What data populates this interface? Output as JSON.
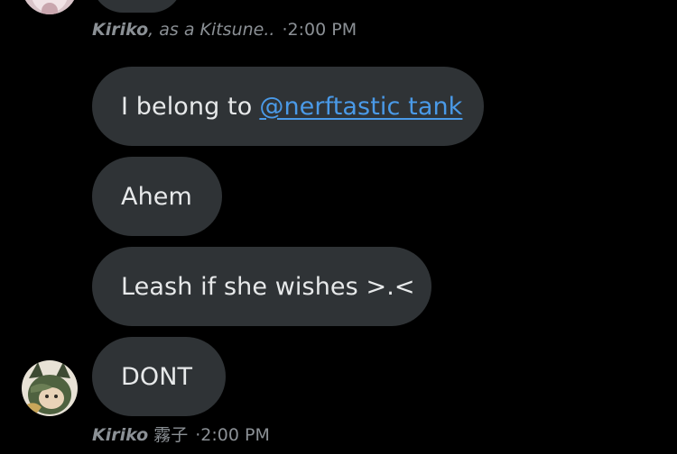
{
  "messages": [
    {
      "text": "I belong to",
      "mention": "@nerftastic tank"
    },
    {
      "text": "Ahem"
    },
    {
      "text": "Leash if she wishes >.<"
    },
    {
      "text": "DONT"
    }
  ],
  "top_meta": {
    "name": "Kiriko",
    "separator": ",",
    "nickname": "as a Kitsune..",
    "time": "·2:00 PM"
  },
  "bottom_meta": {
    "name": "Kiriko",
    "nickname": "霧子",
    "time": "·2:00 PM"
  },
  "colors": {
    "background": "#000000",
    "bubble": "#2f3336",
    "text": "#e7e9ea",
    "meta": "#8b9095",
    "mention": "#4a9ae8"
  }
}
